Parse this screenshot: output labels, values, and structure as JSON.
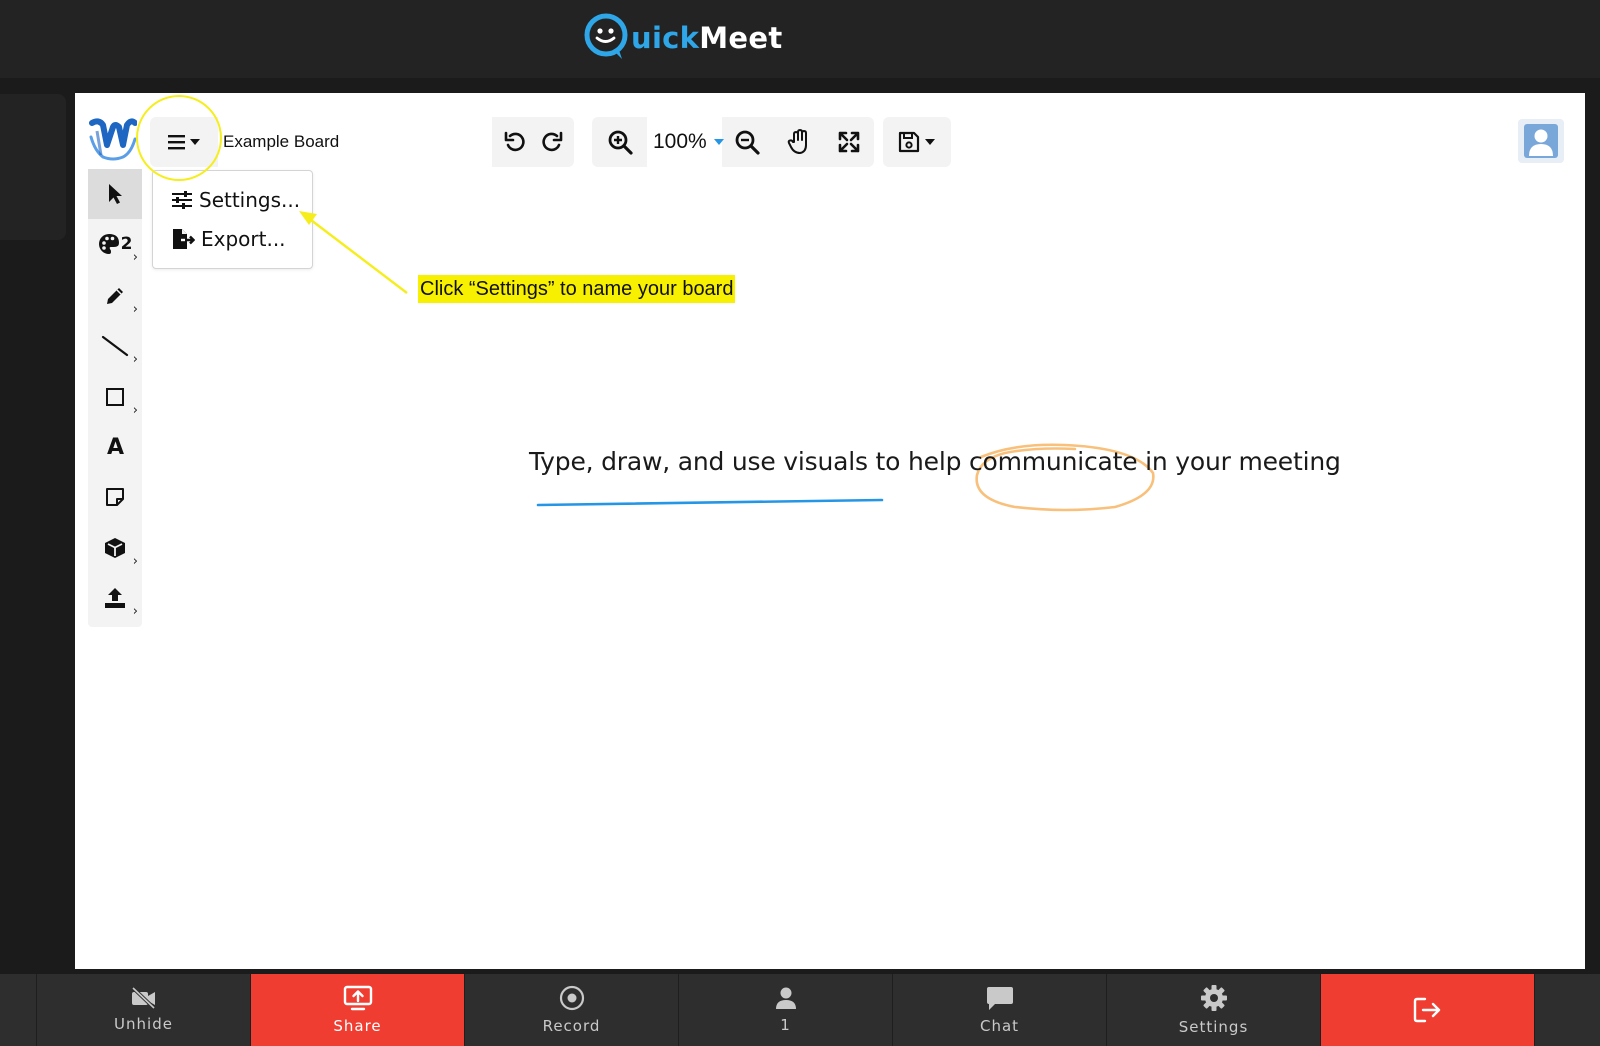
{
  "header": {
    "logo_part1": "uick",
    "logo_part2": "Meet"
  },
  "whiteboard": {
    "board_name": "Example Board",
    "zoom_level": "100%",
    "menu": {
      "items": [
        {
          "label": "Settings...",
          "icon": "sliders-icon"
        },
        {
          "label": "Export...",
          "icon": "file-export-icon"
        }
      ]
    },
    "tools": [
      {
        "name": "select",
        "icon": "cursor-arrow-icon"
      },
      {
        "name": "color",
        "icon": "palette-icon",
        "label": "2"
      },
      {
        "name": "pencil",
        "icon": "pencil-icon"
      },
      {
        "name": "line",
        "icon": "line-icon"
      },
      {
        "name": "rectangle",
        "icon": "square-icon"
      },
      {
        "name": "text",
        "icon": "text-icon",
        "label": "A"
      },
      {
        "name": "sticky-note",
        "icon": "note-icon"
      },
      {
        "name": "3d-shape",
        "icon": "cube-icon"
      },
      {
        "name": "upload",
        "icon": "upload-icon"
      }
    ],
    "content_text": "Type, draw, and use visuals to help communicate in your meeting",
    "annotation_label": "Click “Settings” to name your board",
    "colors": {
      "annotation_yellow": "#f5ee1c",
      "underline_blue": "#2596e6",
      "circle_orange": "#f8c07a"
    }
  },
  "bottom_bar": {
    "buttons": [
      {
        "label": "Unhide",
        "icon": "camera-off-icon"
      },
      {
        "label": "Share",
        "icon": "screen-share-icon",
        "color": "#f03d32"
      },
      {
        "label": "Record",
        "icon": "record-icon"
      },
      {
        "label": "1",
        "icon": "participant-icon"
      },
      {
        "label": "Chat",
        "icon": "chat-icon"
      },
      {
        "label": "Settings",
        "icon": "gear-icon"
      },
      {
        "label": "",
        "icon": "leave-icon",
        "color": "#f03d32"
      }
    ]
  }
}
